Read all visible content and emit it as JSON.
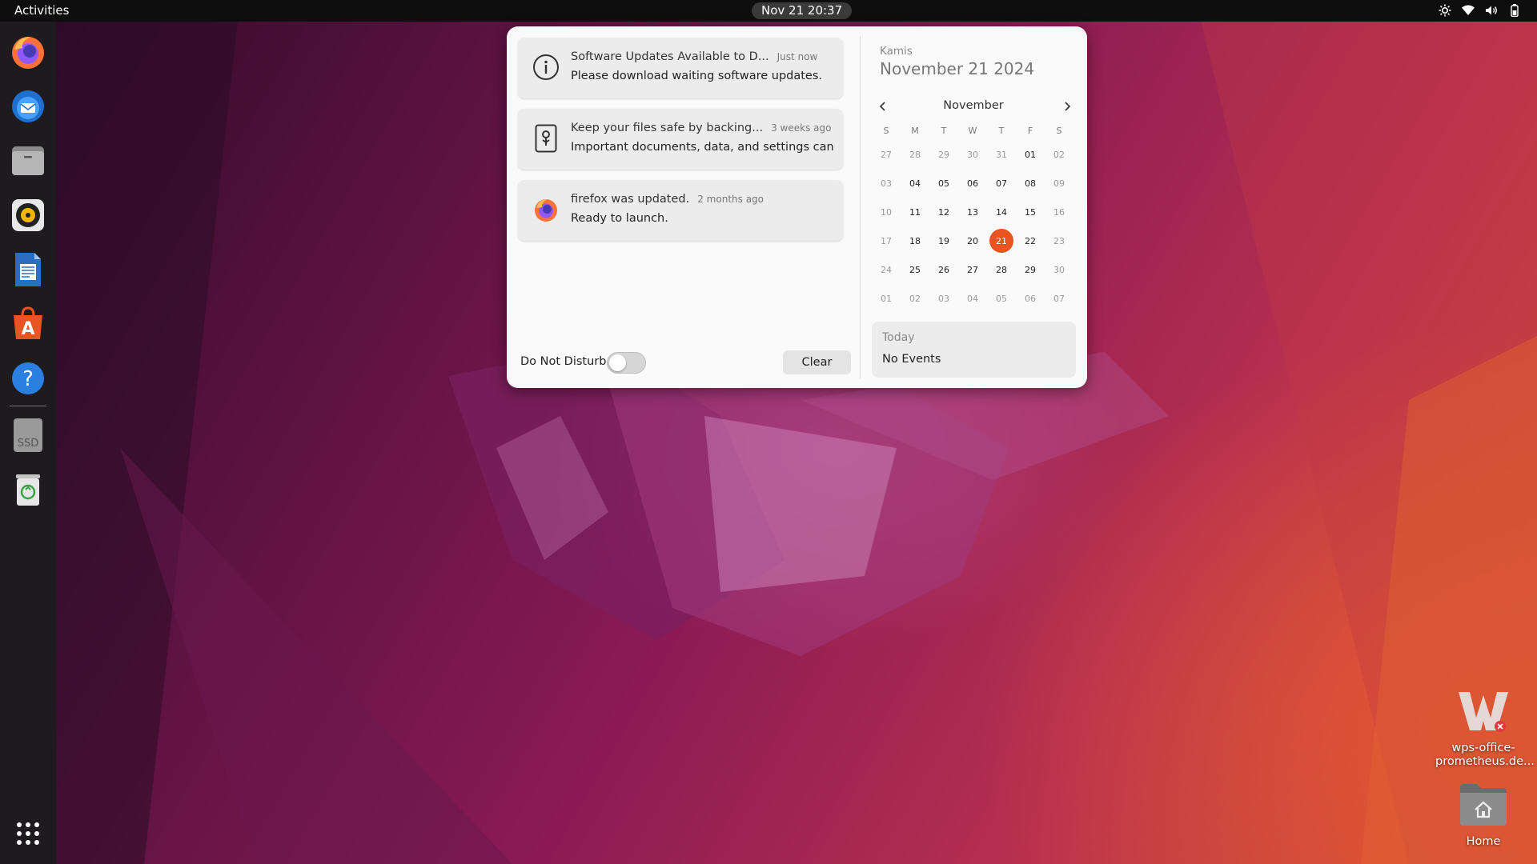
{
  "topbar": {
    "activities": "Activities",
    "clock": "Nov 21  20:37",
    "tray_icons": [
      "brightness-icon",
      "wifi-icon",
      "volume-icon",
      "battery-icon"
    ]
  },
  "dock": {
    "items": [
      "firefox",
      "thunderbird",
      "files",
      "rhythmbox",
      "libreoffice-writer",
      "ubuntu-software",
      "help",
      "ssd-drive",
      "trash"
    ],
    "ssd_label": "SSD",
    "help_glyph": "?",
    "apps_grid": "show-applications"
  },
  "notifications": [
    {
      "icon": "info-icon",
      "title": "Software Updates Available to D...",
      "time": "Just now",
      "body": "Please download waiting software updates."
    },
    {
      "icon": "backup-icon",
      "title": "Keep your files safe by backing...",
      "time": "3 weeks ago",
      "body": "Important documents, data, and settings can b..."
    },
    {
      "icon": "firefox-icon",
      "title": "firefox was updated.",
      "time": "2 months ago",
      "body": "Ready to launch."
    }
  ],
  "dnd": {
    "label": "Do Not Disturb",
    "enabled": false
  },
  "clear_label": "Clear",
  "calendar": {
    "weekday": "Kamis",
    "full_date": "November 21 2024",
    "month": "November",
    "day_headers": [
      "S",
      "M",
      "T",
      "W",
      "T",
      "F",
      "S"
    ],
    "weeks": [
      [
        {
          "d": "27",
          "dim": true
        },
        {
          "d": "28",
          "dim": true
        },
        {
          "d": "29",
          "dim": true
        },
        {
          "d": "30",
          "dim": true
        },
        {
          "d": "31",
          "dim": true
        },
        {
          "d": "01"
        },
        {
          "d": "02",
          "dim": true
        }
      ],
      [
        {
          "d": "03",
          "dim": true
        },
        {
          "d": "04"
        },
        {
          "d": "05"
        },
        {
          "d": "06"
        },
        {
          "d": "07"
        },
        {
          "d": "08"
        },
        {
          "d": "09",
          "dim": true
        }
      ],
      [
        {
          "d": "10",
          "dim": true
        },
        {
          "d": "11"
        },
        {
          "d": "12"
        },
        {
          "d": "13"
        },
        {
          "d": "14"
        },
        {
          "d": "15"
        },
        {
          "d": "16",
          "dim": true
        }
      ],
      [
        {
          "d": "17",
          "dim": true
        },
        {
          "d": "18"
        },
        {
          "d": "19"
        },
        {
          "d": "20"
        },
        {
          "d": "21",
          "today": true
        },
        {
          "d": "22"
        },
        {
          "d": "23",
          "dim": true
        }
      ],
      [
        {
          "d": "24",
          "dim": true
        },
        {
          "d": "25"
        },
        {
          "d": "26"
        },
        {
          "d": "27"
        },
        {
          "d": "28"
        },
        {
          "d": "29"
        },
        {
          "d": "30",
          "dim": true
        }
      ],
      [
        {
          "d": "01",
          "dim": true
        },
        {
          "d": "02",
          "dim": true
        },
        {
          "d": "03",
          "dim": true
        },
        {
          "d": "04",
          "dim": true
        },
        {
          "d": "05",
          "dim": true
        },
        {
          "d": "06",
          "dim": true
        },
        {
          "d": "07",
          "dim": true
        }
      ]
    ],
    "accent": "#e95420"
  },
  "events": {
    "title": "Today",
    "body": "No Events"
  },
  "desktop_icons": [
    {
      "label_1": "wps-office-",
      "label_2": "prometheus.de...",
      "icon": "wps-office-icon"
    },
    {
      "label_1": "Home",
      "icon": "home-folder-icon"
    }
  ]
}
